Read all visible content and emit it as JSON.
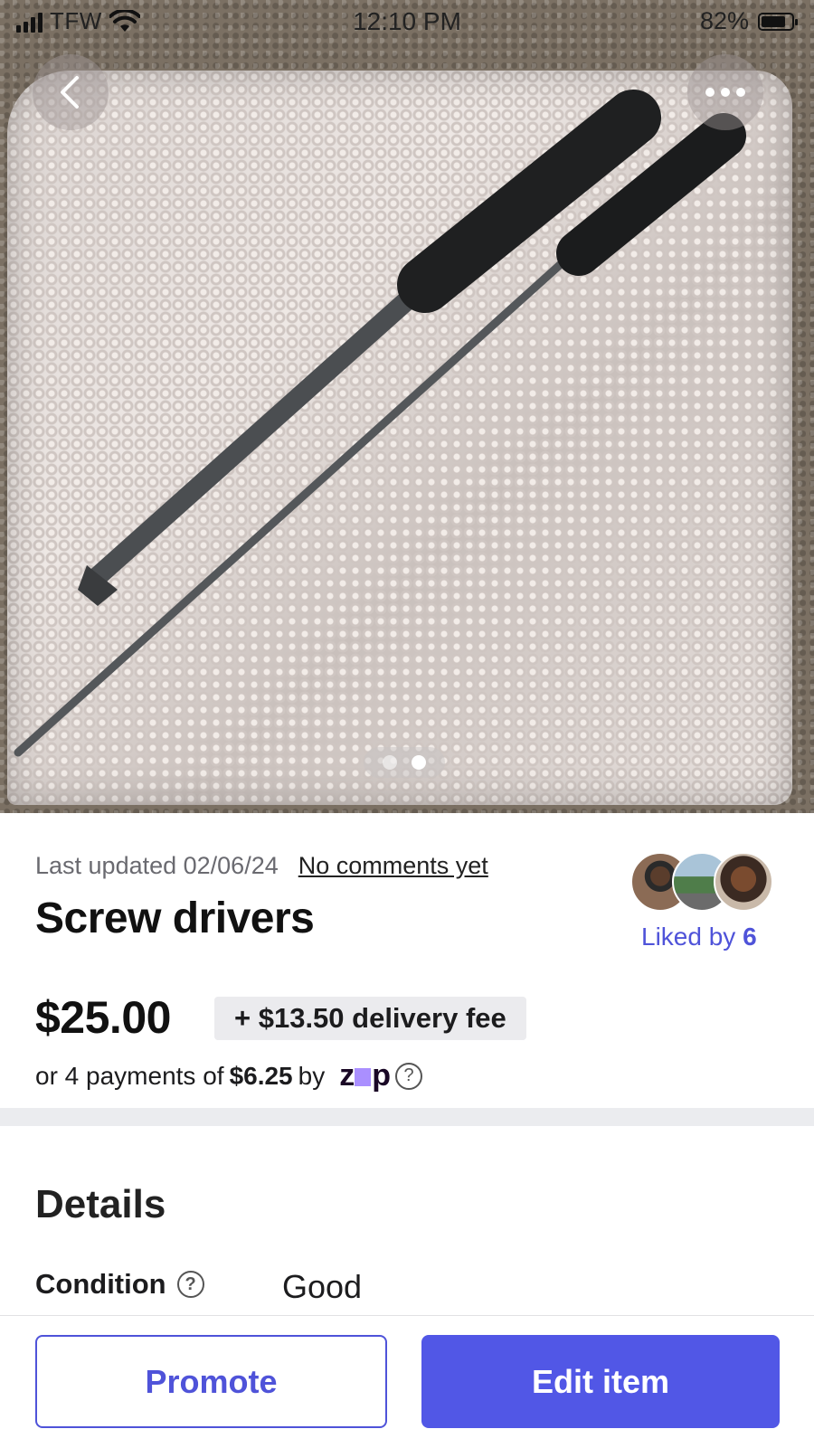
{
  "status_bar": {
    "carrier": "TFW",
    "time": "12:10 PM",
    "battery": "82%",
    "battery_level": 0.82
  },
  "photo": {
    "page_count": 2,
    "active_index": 1,
    "back_icon": "chevron-left-icon",
    "more_icon": "more-horizontal-icon"
  },
  "listing": {
    "last_updated": "Last updated 02/06/24",
    "comments_link": "No comments yet",
    "title": "Screw drivers",
    "liked_prefix": "Liked by",
    "liked_count": "6",
    "price": "$25.00",
    "delivery_fee": "+ $13.50 delivery fee",
    "payments_prefix": "or 4 payments of",
    "payments_amount": "$6.25",
    "payments_by": "by",
    "zip_logo": "zip"
  },
  "details": {
    "heading": "Details",
    "condition_label": "Condition",
    "condition_value": "Good"
  },
  "actions": {
    "promote": "Promote",
    "edit": "Edit item"
  },
  "colors": {
    "accent": "#5157e6",
    "link": "#4f53d9",
    "divider": "#ebecef"
  }
}
